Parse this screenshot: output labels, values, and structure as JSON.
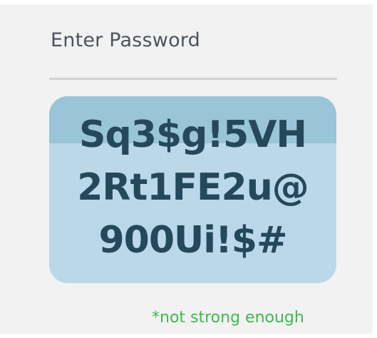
{
  "form": {
    "label": "Enter Password",
    "password_lines": [
      "Sq3$g!5VH",
      "2Rt1FE2u@",
      "900Ui!$#"
    ],
    "strength_message": "*not strong enough"
  },
  "colors": {
    "panel_background": "#f2f2f2",
    "password_box": "#bad8e7",
    "password_box_top_band": "#9ac4d8",
    "password_text": "#25485a",
    "strength_message": "#3fb94a"
  }
}
